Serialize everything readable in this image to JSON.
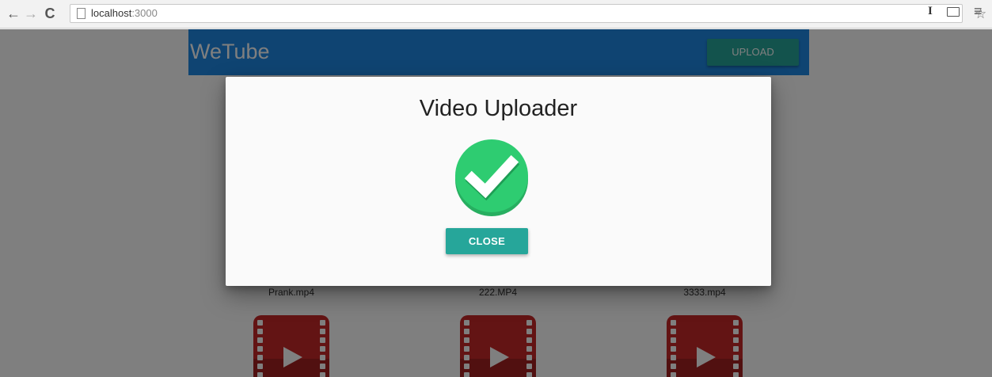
{
  "browser": {
    "url_host": "localhost",
    "url_port": ":3000",
    "back_icon": "←",
    "forward_icon": "→",
    "reload_icon": "C",
    "star_icon": "☆",
    "extension_label": "I",
    "menu_icon": "≡"
  },
  "app": {
    "brand": "WeTube",
    "upload_label": "UPLOAD",
    "colors": {
      "app_bar": "#1e88e5",
      "accent": "#26a69a"
    }
  },
  "videos": [
    {
      "name": "Prank.mp4"
    },
    {
      "name": "222.MP4"
    },
    {
      "name": "3333.mp4"
    }
  ],
  "modal": {
    "title": "Video Uploader",
    "status_icon": "check-circle-icon",
    "close_label": "CLOSE",
    "colors": {
      "success": "#2ecc71"
    }
  }
}
